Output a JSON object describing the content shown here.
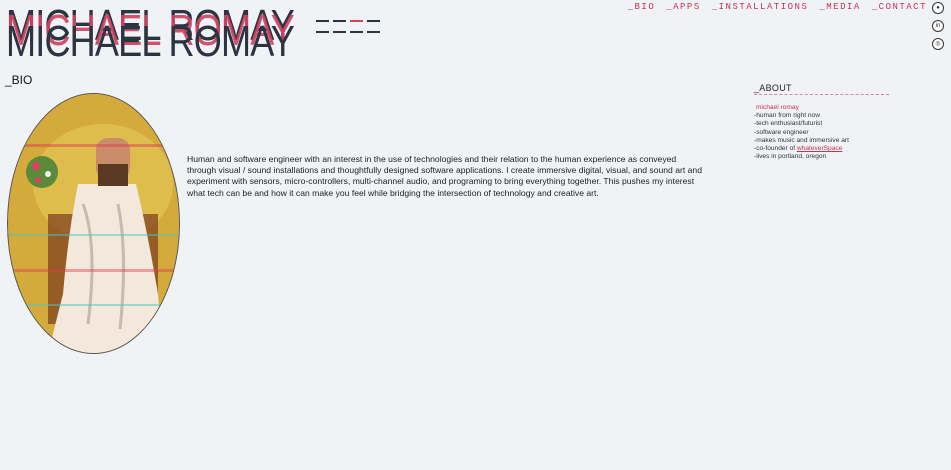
{
  "header": {
    "logo_text": "MICHAEL ROMAY",
    "nav": [
      "_BIO",
      "_APPS",
      "_INSTALLATIONS",
      "_MEDIA",
      "_CONTACT"
    ],
    "social_icons": [
      "github-icon",
      "linkedin-icon",
      "instagram-icon"
    ]
  },
  "section": {
    "title": "_BIO"
  },
  "bio": {
    "text": "Human and software engineer with an interest in the use of technologies and their relation to the human experience as conveyed through visual / sound installations and thoughtfully designed software applications. I create immersive digital, visual, and sound art and experiment with sensors, micro-controllers, multi-channel audio, and programing to bring everything together. This pushes my interest what tech can be and how it can make you feel while bridging the intersection of technology and creative art."
  },
  "about": {
    "title": "_ABOUT",
    "name": "michael romay",
    "items": [
      "-human from right now",
      "-tech enthusiast/futurist",
      "-software engineer",
      "-makes music and immersive art"
    ],
    "cofounder_prefix": "-co-founder of ",
    "cofounder_link": "whateverSpace",
    "location": "-lives in portland, oregon"
  },
  "colors": {
    "accent": "#c4334f",
    "logo_dark": "#2c3442",
    "logo_red": "#d04462",
    "background": "#f0f3f6",
    "portrait_bg": "#cfa537"
  }
}
